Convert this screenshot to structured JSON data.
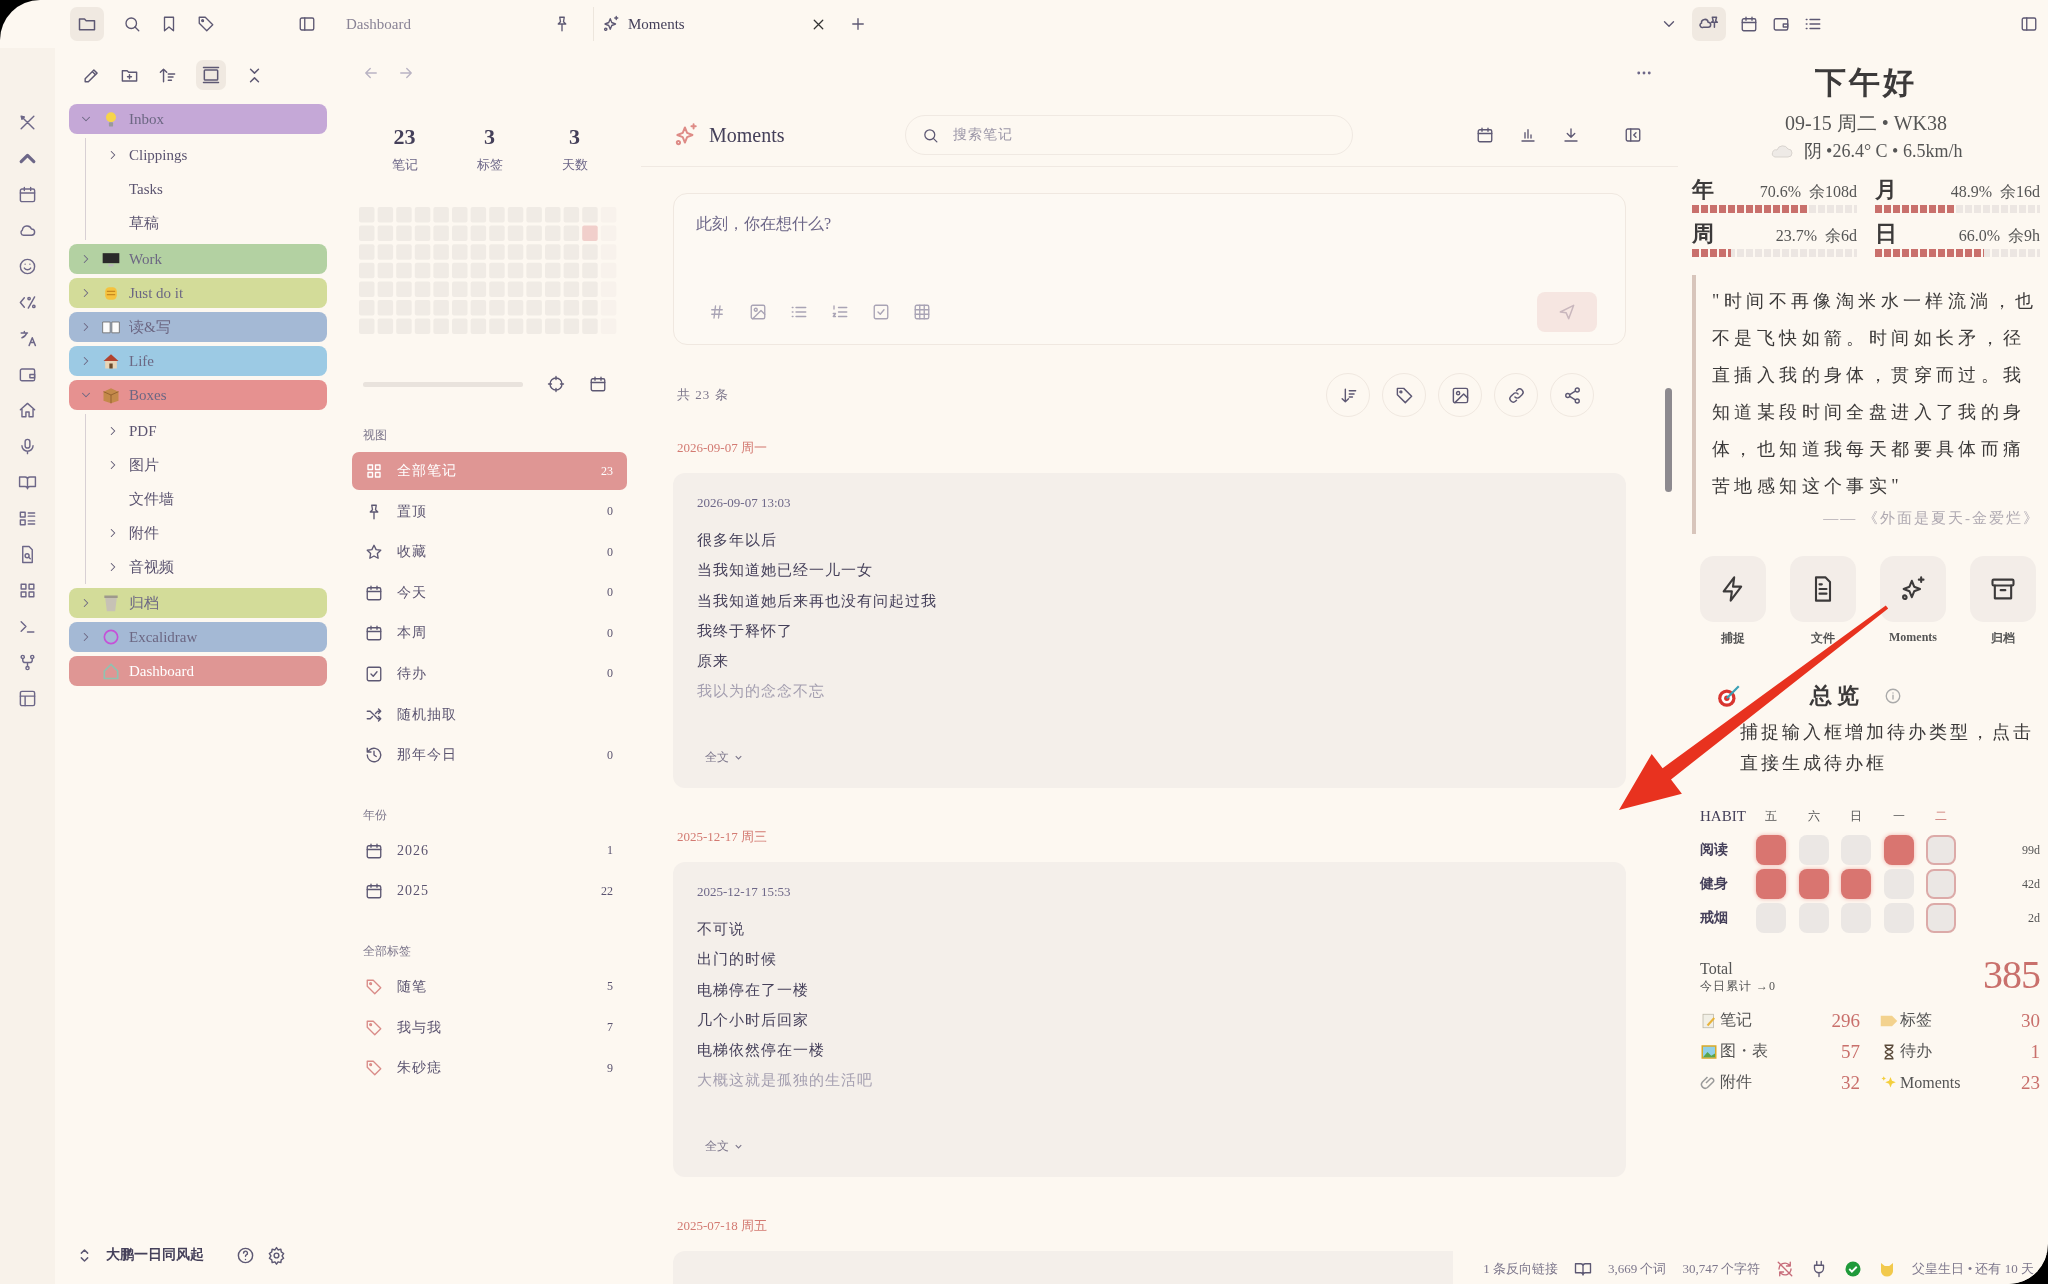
{
  "tabs": [
    {
      "label": "Dashboard",
      "selected": false,
      "kind": "pinned"
    },
    {
      "label": "Moments",
      "selected": true,
      "kind": "closable"
    }
  ],
  "tree": {
    "items": [
      {
        "label": "Inbox",
        "color": "#c5a8d7",
        "kind": "folder",
        "expanded": true,
        "children": [
          {
            "label": "Clippings",
            "kind": "folder"
          },
          {
            "label": "Tasks",
            "kind": "note"
          },
          {
            "label": "草稿",
            "kind": "note"
          }
        ]
      },
      {
        "label": "Work",
        "color": "#b3d1a2",
        "kind": "folder",
        "expanded": false
      },
      {
        "label": "Just do it",
        "color": "#d3dc99",
        "kind": "folder",
        "expanded": false
      },
      {
        "label": "读&写",
        "color": "#a4b9d5",
        "kind": "folder",
        "expanded": false
      },
      {
        "label": "Life",
        "color": "#9ccae4",
        "kind": "folder",
        "expanded": false
      },
      {
        "label": "Boxes",
        "color": "#e69190",
        "kind": "folder",
        "expanded": true,
        "children": [
          {
            "label": "PDF",
            "kind": "folder"
          },
          {
            "label": "图片",
            "kind": "folder"
          },
          {
            "label": "文件墙",
            "kind": "note"
          },
          {
            "label": "附件",
            "kind": "folder"
          },
          {
            "label": "音视频",
            "kind": "folder"
          }
        ]
      },
      {
        "label": "归档",
        "color": "#d3dc99",
        "kind": "folder",
        "expanded": false
      },
      {
        "label": "Excalidraw",
        "color": "#a4b9d5",
        "kind": "folder",
        "expanded": false
      },
      {
        "label": "Dashboard",
        "color": "#df9694",
        "kind": "note"
      }
    ],
    "footer": "大鹏一日同风起"
  },
  "range": {
    "level": 1
  },
  "stats": [
    {
      "value": "23",
      "label": "笔记"
    },
    {
      "value": "3",
      "label": "标签"
    },
    {
      "value": "3",
      "label": "天数"
    }
  ],
  "sections": [
    {
      "title": "视图",
      "items": [
        {
          "label": "全部笔记",
          "count": "23",
          "selected": true
        },
        {
          "label": "置顶",
          "count": "0",
          "selected": false
        },
        {
          "label": "收藏",
          "count": "0",
          "selected": false
        },
        {
          "label": "今天",
          "count": "0",
          "selected": false
        },
        {
          "label": "本周",
          "count": "0",
          "selected": false
        },
        {
          "label": "待办",
          "count": "0",
          "selected": false
        },
        {
          "label": "随机抽取",
          "selected": false
        },
        {
          "label": "那年今日",
          "count": "0",
          "selected": false
        }
      ]
    },
    {
      "title": "年份",
      "items": [
        {
          "label": "2026",
          "count": "1",
          "selected": false
        },
        {
          "label": "2025",
          "count": "22",
          "selected": false
        }
      ]
    },
    {
      "title": "全部标签",
      "items": [
        {
          "label": "随笔",
          "count": "5",
          "selected": false
        },
        {
          "label": "我与我",
          "count": "7",
          "selected": false
        },
        {
          "label": "朱砂痣",
          "count": "9",
          "selected": false
        }
      ]
    }
  ],
  "main": {
    "title": "Moments",
    "search": {
      "placeholder": "搜索笔记"
    },
    "composer": {
      "placeholder": "此刻，你在想什么?"
    },
    "total": "共 23 条",
    "groups": [
      {
        "date": "2026-09-07 周一",
        "time": "2026-09-07 13:03",
        "lines": [
          "很多年以后",
          "当我知道她已经一儿一女",
          "当我知道她后来再也没有问起过我",
          "我终于释怀了",
          "原来",
          "我以为的念念不忘"
        ],
        "more": "全文"
      },
      {
        "date": "2025-12-17 周三",
        "time": "2025-12-17 15:53",
        "lines": [
          "不可说",
          "出门的时候",
          "电梯停在了一楼",
          "几个小时后回家",
          "电梯依然停在一楼",
          "大概这就是孤独的生活吧"
        ],
        "more": "全文"
      },
      {
        "date": "2025-07-18 周五"
      }
    ]
  },
  "right": {
    "greeting": "下午好",
    "date_line": "09-15 周二 • WK38",
    "weather": "阴 •26.4° C • 6.5km/h",
    "progress": [
      {
        "label": "年",
        "percent": "70.6%",
        "remain": "余108d",
        "level": 0.706
      },
      {
        "label": "月",
        "percent": "48.9%",
        "remain": "余16d",
        "level": 0.489
      },
      {
        "label": "周",
        "percent": "23.7%",
        "remain": "余6d",
        "level": 0.237
      },
      {
        "label": "日",
        "percent": "66.0%",
        "remain": "余9h",
        "level": 0.66
      }
    ],
    "quote": {
      "text": "\"时间不再像淘米水一样流淌，也不是飞快如箭。时间如长矛，径直插入我的身体，贯穿而过。我知道某段时间全盘进入了我的身体，也知道我每天都要具体而痛苦地感知这个事实\"",
      "source": "—— 《外面是夏天-金爱烂》"
    },
    "quick": [
      {
        "label": "捕捉"
      },
      {
        "label": "文件"
      },
      {
        "label": "Moments"
      },
      {
        "label": "归档"
      }
    ],
    "todo": {
      "title": "总览",
      "description": "捕捉输入框增加待办类型，点击直接生成待办框"
    },
    "habit": {
      "title": "HABIT",
      "days": [
        {
          "label": "五",
          "today": false
        },
        {
          "label": "六",
          "today": false
        },
        {
          "label": "日",
          "today": false
        },
        {
          "label": "一",
          "today": false
        },
        {
          "label": "二",
          "today": true
        }
      ],
      "rows": [
        {
          "name": "阅读",
          "done": [
            true,
            false,
            false,
            true,
            false
          ],
          "streak": "99d"
        },
        {
          "name": "健身",
          "done": [
            true,
            true,
            true,
            false,
            false
          ],
          "streak": "42d"
        },
        {
          "name": "戒烟",
          "done": [
            false,
            false,
            false,
            false,
            false
          ],
          "streak": "2d"
        }
      ]
    },
    "total": {
      "label": "Total",
      "today": "今日累计 →0",
      "value": "385"
    },
    "counts": [
      {
        "label": "笔记",
        "value": "296"
      },
      {
        "label": "标签",
        "value": "30"
      },
      {
        "label": "图・表",
        "value": "57"
      },
      {
        "label": "待办",
        "value": "1"
      },
      {
        "label": "附件",
        "value": "32"
      },
      {
        "label": "Moments",
        "value": "23"
      }
    ]
  },
  "status": {
    "backlinks": "1 条反向链接",
    "words": "3,669 个词",
    "chars": "30,747 个字符",
    "reminder": "父皇生日 • 还有 10 天"
  }
}
